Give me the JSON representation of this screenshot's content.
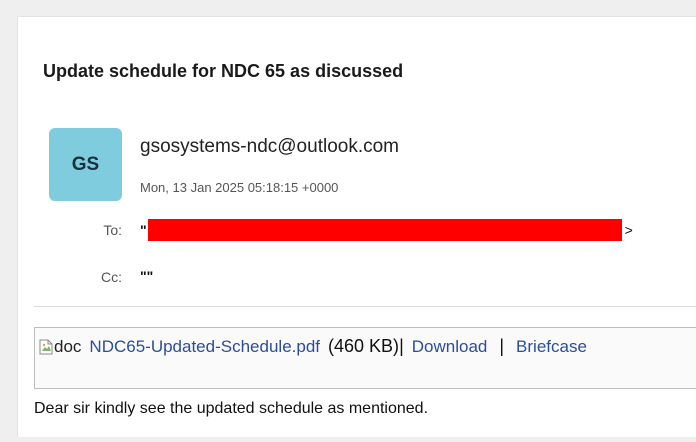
{
  "email": {
    "subject": "Update schedule for NDC 65 as discussed",
    "avatar_initials": "GS",
    "avatar_color": "#80ccdf",
    "sender": "gsosystems-ndc@outlook.com",
    "date": "Mon, 13 Jan 2025 05:18:15 +0000",
    "to_label": "To:",
    "to_open": "\"",
    "to_close": ">",
    "cc_label": "Cc:",
    "cc_value": "\"\"",
    "redaction_color": "#ff0000"
  },
  "attachment": {
    "icon_alt": "doc",
    "file_name": "NDC65-Updated-Schedule.pdf",
    "file_size": "(460 KB)",
    "separator": "|",
    "download_label": "Download",
    "briefcase_label": "Briefcase",
    "link_color": "#2a4d9c"
  },
  "body": {
    "text": "Dear sir kindly see the updated schedule as mentioned."
  }
}
